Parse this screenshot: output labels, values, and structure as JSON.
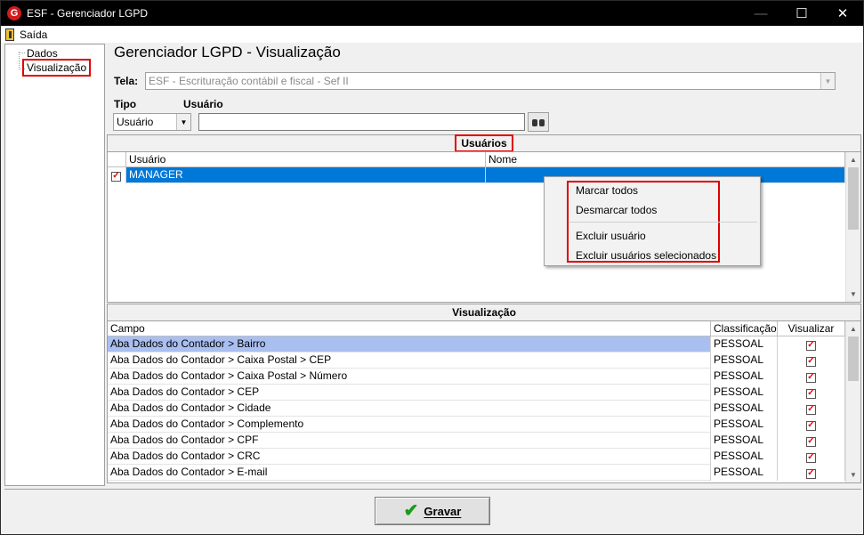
{
  "window": {
    "title": "ESF - Gerenciador LGPD",
    "icon_letter": "G",
    "minimize_label": "—",
    "maximize_label": "☐",
    "close_label": "✕"
  },
  "menu": {
    "exit_label": "Saída"
  },
  "tree": {
    "items": [
      "Dados",
      "Visualização"
    ]
  },
  "page": {
    "heading": "Gerenciador LGPD - Visualização"
  },
  "tela": {
    "label": "Tela:",
    "value": "ESF - Escrituração contábil e fiscal - Sef II"
  },
  "filters": {
    "tipo_label": "Tipo",
    "tipo_value": "Usuário",
    "usuario_label": "Usuário",
    "usuario_value": ""
  },
  "usuarios": {
    "title": "Usuários",
    "columns": [
      "Usuário",
      "Nome"
    ],
    "rows": [
      {
        "checked": true,
        "usuario": "MANAGER",
        "nome": ""
      }
    ]
  },
  "context_menu": {
    "items": [
      "Marcar todos",
      "Desmarcar todos",
      "Excluir usuário",
      "Excluir usuários selecionados"
    ]
  },
  "visualizacao": {
    "title": "Visualização",
    "columns": [
      "Campo",
      "Classificação",
      "Visualizar"
    ],
    "rows": [
      {
        "campo": "Aba Dados do Contador > Bairro",
        "classificacao": "PESSOAL",
        "visualizar": true
      },
      {
        "campo": "Aba Dados do Contador > Caixa Postal > CEP",
        "classificacao": "PESSOAL",
        "visualizar": true
      },
      {
        "campo": "Aba Dados do Contador > Caixa Postal > Número",
        "classificacao": "PESSOAL",
        "visualizar": true
      },
      {
        "campo": "Aba Dados do Contador > CEP",
        "classificacao": "PESSOAL",
        "visualizar": true
      },
      {
        "campo": "Aba Dados do Contador > Cidade",
        "classificacao": "PESSOAL",
        "visualizar": true
      },
      {
        "campo": "Aba Dados do Contador > Complemento",
        "classificacao": "PESSOAL",
        "visualizar": true
      },
      {
        "campo": "Aba Dados do Contador > CPF",
        "classificacao": "PESSOAL",
        "visualizar": true
      },
      {
        "campo": "Aba Dados do Contador > CRC",
        "classificacao": "PESSOAL",
        "visualizar": true
      },
      {
        "campo": "Aba Dados do Contador > E-mail",
        "classificacao": "PESSOAL",
        "visualizar": true
      }
    ]
  },
  "footer": {
    "save_label": "Gravar"
  },
  "colors": {
    "selection": "#0078d7",
    "highlight": "#a9bff0",
    "annotation": "#e00000"
  }
}
